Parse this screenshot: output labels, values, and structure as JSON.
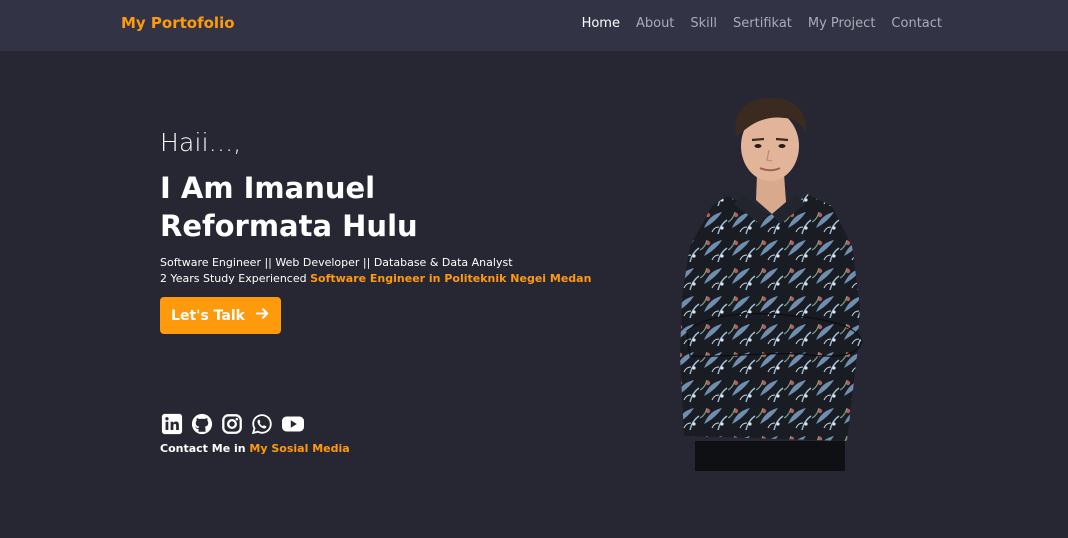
{
  "brand": "My Portofolio",
  "nav": {
    "home": "Home",
    "about": "About",
    "skill": "Skill",
    "sertifikat": "Sertifikat",
    "project": "My Project",
    "contact": "Contact"
  },
  "hero": {
    "greeting": "Haii...,",
    "name_line1": "I Am Imanuel",
    "name_line2": "Reformata Hulu",
    "roles": "Software Engineer || Web Developer || Database & Data Analyst",
    "experience_prefix": "2 Years Study Experienced ",
    "experience_highlight": "Software Engineer in Politeknik Negei Medan",
    "cta_label": "Let's Talk"
  },
  "social": {
    "icons": [
      "linkedin-icon",
      "github-icon",
      "instagram-icon",
      "whatsapp-icon",
      "youtube-icon"
    ],
    "contact_prefix": "Contact Me in ",
    "contact_highlight": "My Sosial Media"
  },
  "colors": {
    "accent": "#ff9a0d",
    "background": "#262733",
    "navbar": "#323446"
  }
}
